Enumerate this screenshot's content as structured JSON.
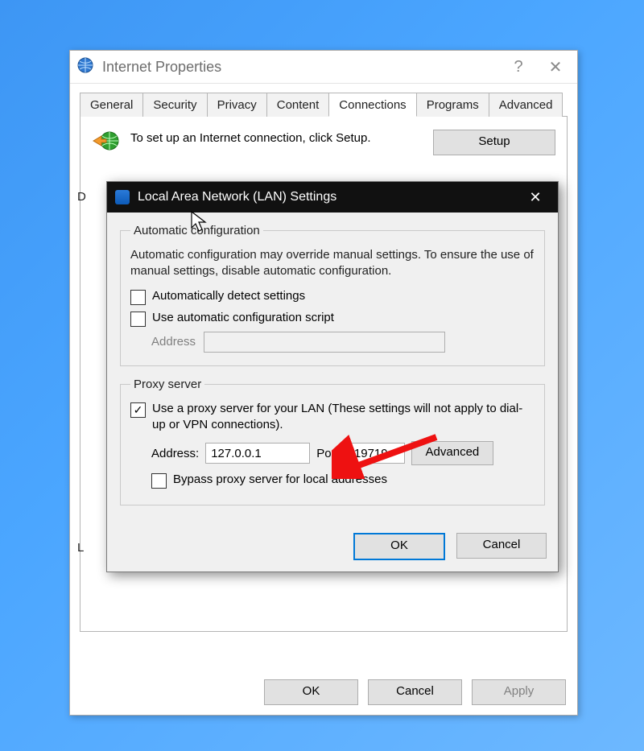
{
  "parent": {
    "title": "Internet Properties",
    "help_glyph": "?",
    "close_glyph": "✕",
    "tabs": [
      "General",
      "Security",
      "Privacy",
      "Content",
      "Connections",
      "Programs",
      "Advanced"
    ],
    "active_tab_index": 4,
    "setup_text": "To set up an Internet connection, click Setup.",
    "setup_button": "Setup",
    "truncated_left_d": "D",
    "truncated_left_l": "L",
    "footer": {
      "ok": "OK",
      "cancel": "Cancel",
      "apply": "Apply"
    }
  },
  "lan": {
    "title": "Local Area Network (LAN) Settings",
    "close_glyph": "✕",
    "auto": {
      "legend": "Automatic configuration",
      "desc": "Automatic configuration may override manual settings.  To ensure the use of manual settings, disable automatic configuration.",
      "detect_label": "Automatically detect settings",
      "detect_checked": false,
      "script_label": "Use automatic configuration script",
      "script_checked": false,
      "address_label": "Address",
      "address_value": ""
    },
    "proxy": {
      "legend": "Proxy server",
      "use_label": "Use a proxy server for your LAN (These settings will not apply to dial-up or VPN connections).",
      "use_checked": true,
      "address_label": "Address:",
      "address_value": "127.0.0.1",
      "port_label": "Port:",
      "port_value": "19719",
      "advanced_button": "Advanced",
      "bypass_label": "Bypass proxy server for local addresses",
      "bypass_checked": false
    },
    "footer": {
      "ok": "OK",
      "cancel": "Cancel"
    }
  },
  "glyphs": {
    "check": "✓"
  }
}
